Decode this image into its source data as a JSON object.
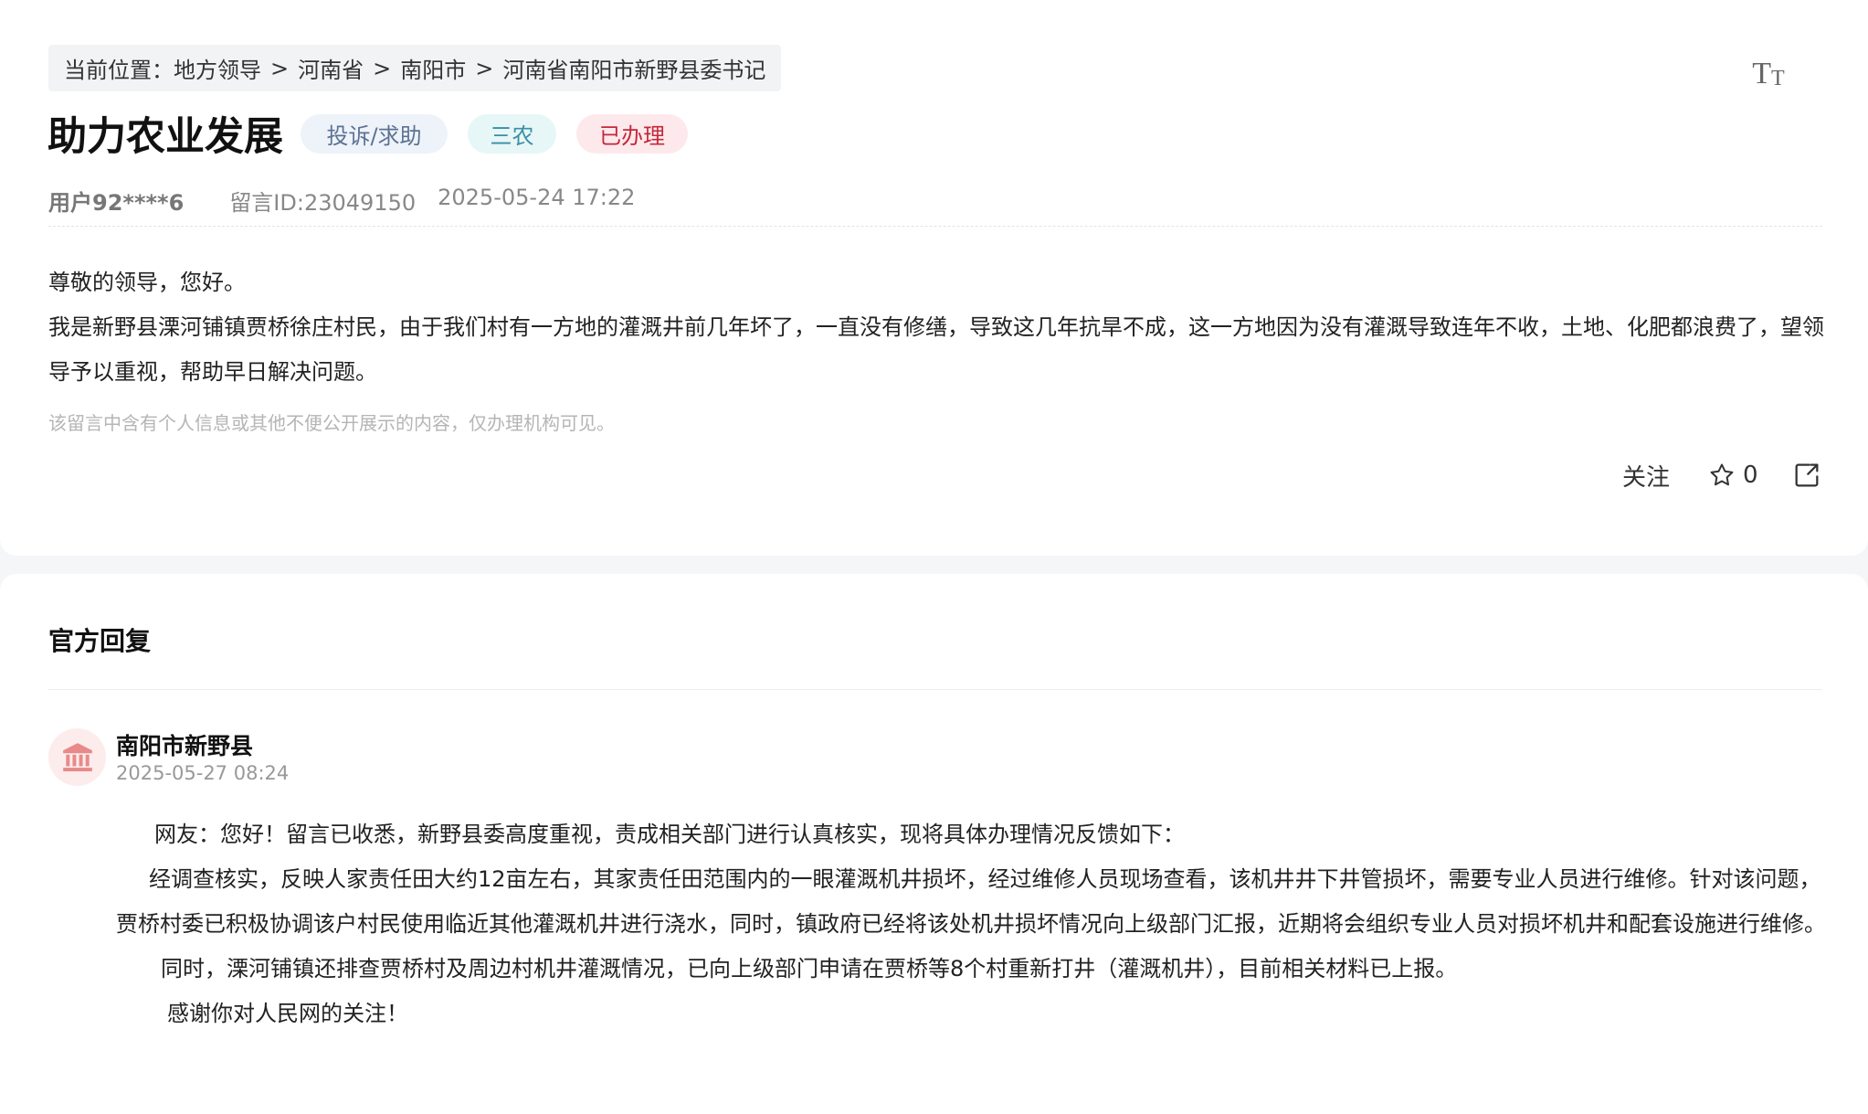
{
  "breadcrumb": {
    "prefix": "当前位置：",
    "items": [
      "地方领导",
      "河南省",
      "南阳市",
      "河南省南阳市新野县委书记"
    ],
    "separator": ">"
  },
  "fontsize_button": {
    "big": "T",
    "small": "T"
  },
  "post": {
    "title": "助力农业发展",
    "tags": {
      "type": "投诉/求助",
      "category": "三农",
      "status": "已办理"
    },
    "user": "用户92****6",
    "message_id": "留言ID:23049150",
    "datetime": "2025-05-24 17:22",
    "paragraphs": [
      "尊敬的领导，您好。",
      "我是新野县溧河铺镇贾桥徐庄村民，由于我们村有一方地的灌溉井前几年坏了，一直没有修缮，导致这几年抗旱不成，这一方地因为没有灌溉导致连年不收，土地、化肥都浪费了，望领导予以重视，帮助早日解决问题。"
    ],
    "privacy_notice": "该留言中含有个人信息或其他不便公开展示的内容，仅办理机构可见。",
    "actions": {
      "follow": "关注",
      "star_count": "0"
    }
  },
  "reply": {
    "heading": "官方回复",
    "org": "南阳市新野县",
    "datetime": "2025-05-27 08:24",
    "paragraphs": [
      "网友：您好！留言已收悉，新野县委高度重视，责成相关部门进行认真核实，现将具体办理情况反馈如下：",
      "经调查核实，反映人家责任田大约12亩左右，其家责任田范围内的一眼灌溉机井损坏，经过维修人员现场查看，该机井井下井管损坏，需要专业人员进行维修。针对该问题，贾桥村委已积极协调该户村民使用临近其他灌溉机井进行浇水，同时，镇政府已经将该处机井损坏情况向上级部门汇报，近期将会组织专业人员对损坏机井和配套设施进行维修。",
      "同时，溧河铺镇还排查贾桥村及周边村机井灌溉情况，已向上级部门申请在贾桥等8个村重新打井（灌溉机井），目前相关材料已上报。",
      "感谢你对人民网的关注！"
    ]
  },
  "colors": {
    "tag_status": "#c5283b",
    "tag_category": "#3a8fa6",
    "tag_type": "#5c7292",
    "avatar_icon": "#e88a8a"
  }
}
